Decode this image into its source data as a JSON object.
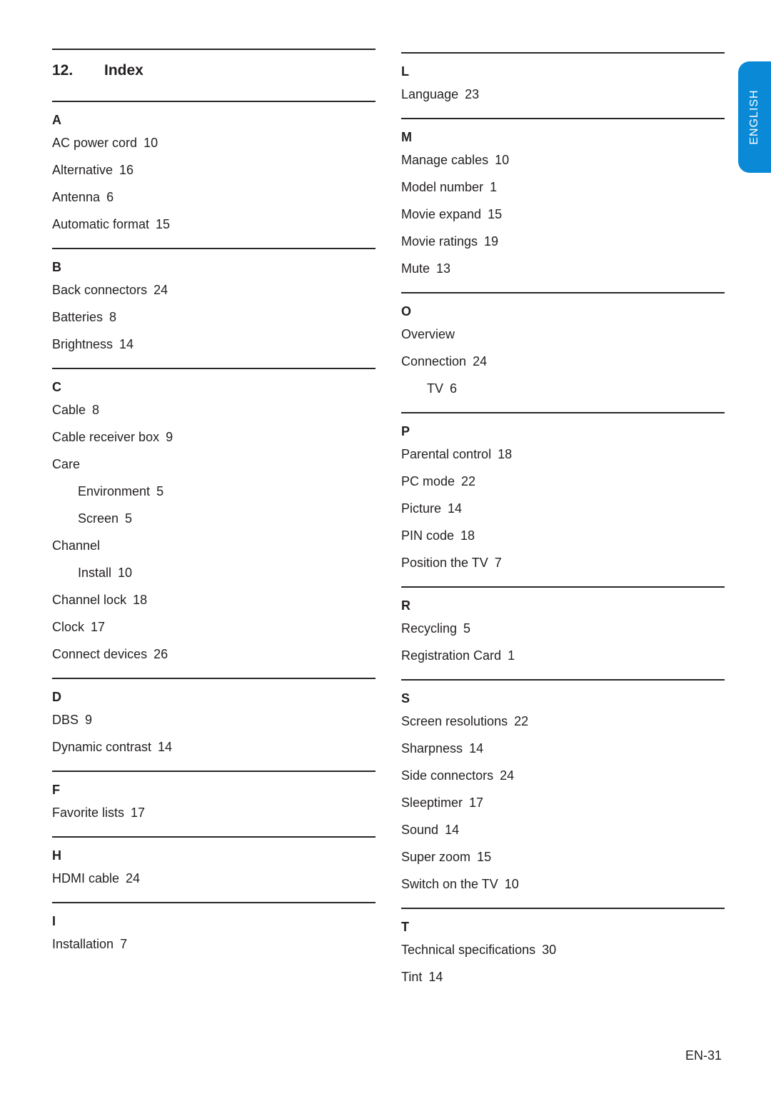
{
  "header": {
    "chapter_number": "12.",
    "chapter_title": "Index"
  },
  "language_tab": "ENGLISH",
  "page_number": "EN-31",
  "left_column": [
    {
      "letter": "A",
      "entries": [
        {
          "term": "AC power cord",
          "page": "10"
        },
        {
          "term": "Alternative",
          "page": "16"
        },
        {
          "term": "Antenna",
          "page": "6"
        },
        {
          "term": "Automatic format",
          "page": "15"
        }
      ]
    },
    {
      "letter": "B",
      "entries": [
        {
          "term": "Back connectors",
          "page": "24"
        },
        {
          "term": "Batteries",
          "page": "8"
        },
        {
          "term": "Brightness",
          "page": "14"
        }
      ]
    },
    {
      "letter": "C",
      "entries": [
        {
          "term": "Cable",
          "page": "8"
        },
        {
          "term": "Cable receiver box",
          "page": "9"
        },
        {
          "term": "Care",
          "page": ""
        },
        {
          "term": "Environment",
          "page": "5",
          "sub": true
        },
        {
          "term": "Screen",
          "page": "5",
          "sub": true
        },
        {
          "term": "Channel",
          "page": ""
        },
        {
          "term": "Install",
          "page": "10",
          "sub": true
        },
        {
          "term": "Channel lock",
          "page": "18"
        },
        {
          "term": "Clock",
          "page": "17"
        },
        {
          "term": "Connect devices",
          "page": "26"
        }
      ]
    },
    {
      "letter": "D",
      "entries": [
        {
          "term": "DBS",
          "page": "9"
        },
        {
          "term": "Dynamic contrast",
          "page": "14"
        }
      ]
    },
    {
      "letter": "F",
      "entries": [
        {
          "term": "Favorite lists",
          "page": "17"
        }
      ]
    },
    {
      "letter": "H",
      "entries": [
        {
          "term": "HDMI cable",
          "page": "24"
        }
      ]
    },
    {
      "letter": "I",
      "entries": [
        {
          "term": "Installation",
          "page": "7"
        }
      ]
    }
  ],
  "right_column": [
    {
      "letter": "L",
      "entries": [
        {
          "term": "Language",
          "page": "23"
        }
      ]
    },
    {
      "letter": "M",
      "entries": [
        {
          "term": "Manage cables",
          "page": "10"
        },
        {
          "term": "Model number",
          "page": "1"
        },
        {
          "term": "Movie expand",
          "page": "15"
        },
        {
          "term": "Movie ratings",
          "page": "19"
        },
        {
          "term": "Mute",
          "page": "13"
        }
      ]
    },
    {
      "letter": "O",
      "entries": [
        {
          "term": "Overview",
          "page": ""
        },
        {
          "term": "Connection",
          "page": "24"
        },
        {
          "term": "TV",
          "page": "6",
          "sub": true
        }
      ]
    },
    {
      "letter": "P",
      "entries": [
        {
          "term": "Parental control",
          "page": "18"
        },
        {
          "term": "PC mode",
          "page": "22"
        },
        {
          "term": "Picture",
          "page": "14"
        },
        {
          "term": "PIN code",
          "page": "18"
        },
        {
          "term": "Position the TV",
          "page": "7"
        }
      ]
    },
    {
      "letter": "R",
      "entries": [
        {
          "term": "Recycling",
          "page": "5"
        },
        {
          "term": "Registration Card",
          "page": "1"
        }
      ]
    },
    {
      "letter": "S",
      "entries": [
        {
          "term": "Screen resolutions",
          "page": "22"
        },
        {
          "term": "Sharpness",
          "page": "14"
        },
        {
          "term": "Side connectors",
          "page": "24"
        },
        {
          "term": "Sleeptimer",
          "page": "17"
        },
        {
          "term": "Sound",
          "page": "14"
        },
        {
          "term": "Super zoom",
          "page": "15"
        },
        {
          "term": "Switch on the TV",
          "page": "10"
        }
      ]
    },
    {
      "letter": "T",
      "entries": [
        {
          "term": "Technical specifications",
          "page": "30"
        },
        {
          "term": "Tint",
          "page": "14"
        }
      ]
    }
  ]
}
